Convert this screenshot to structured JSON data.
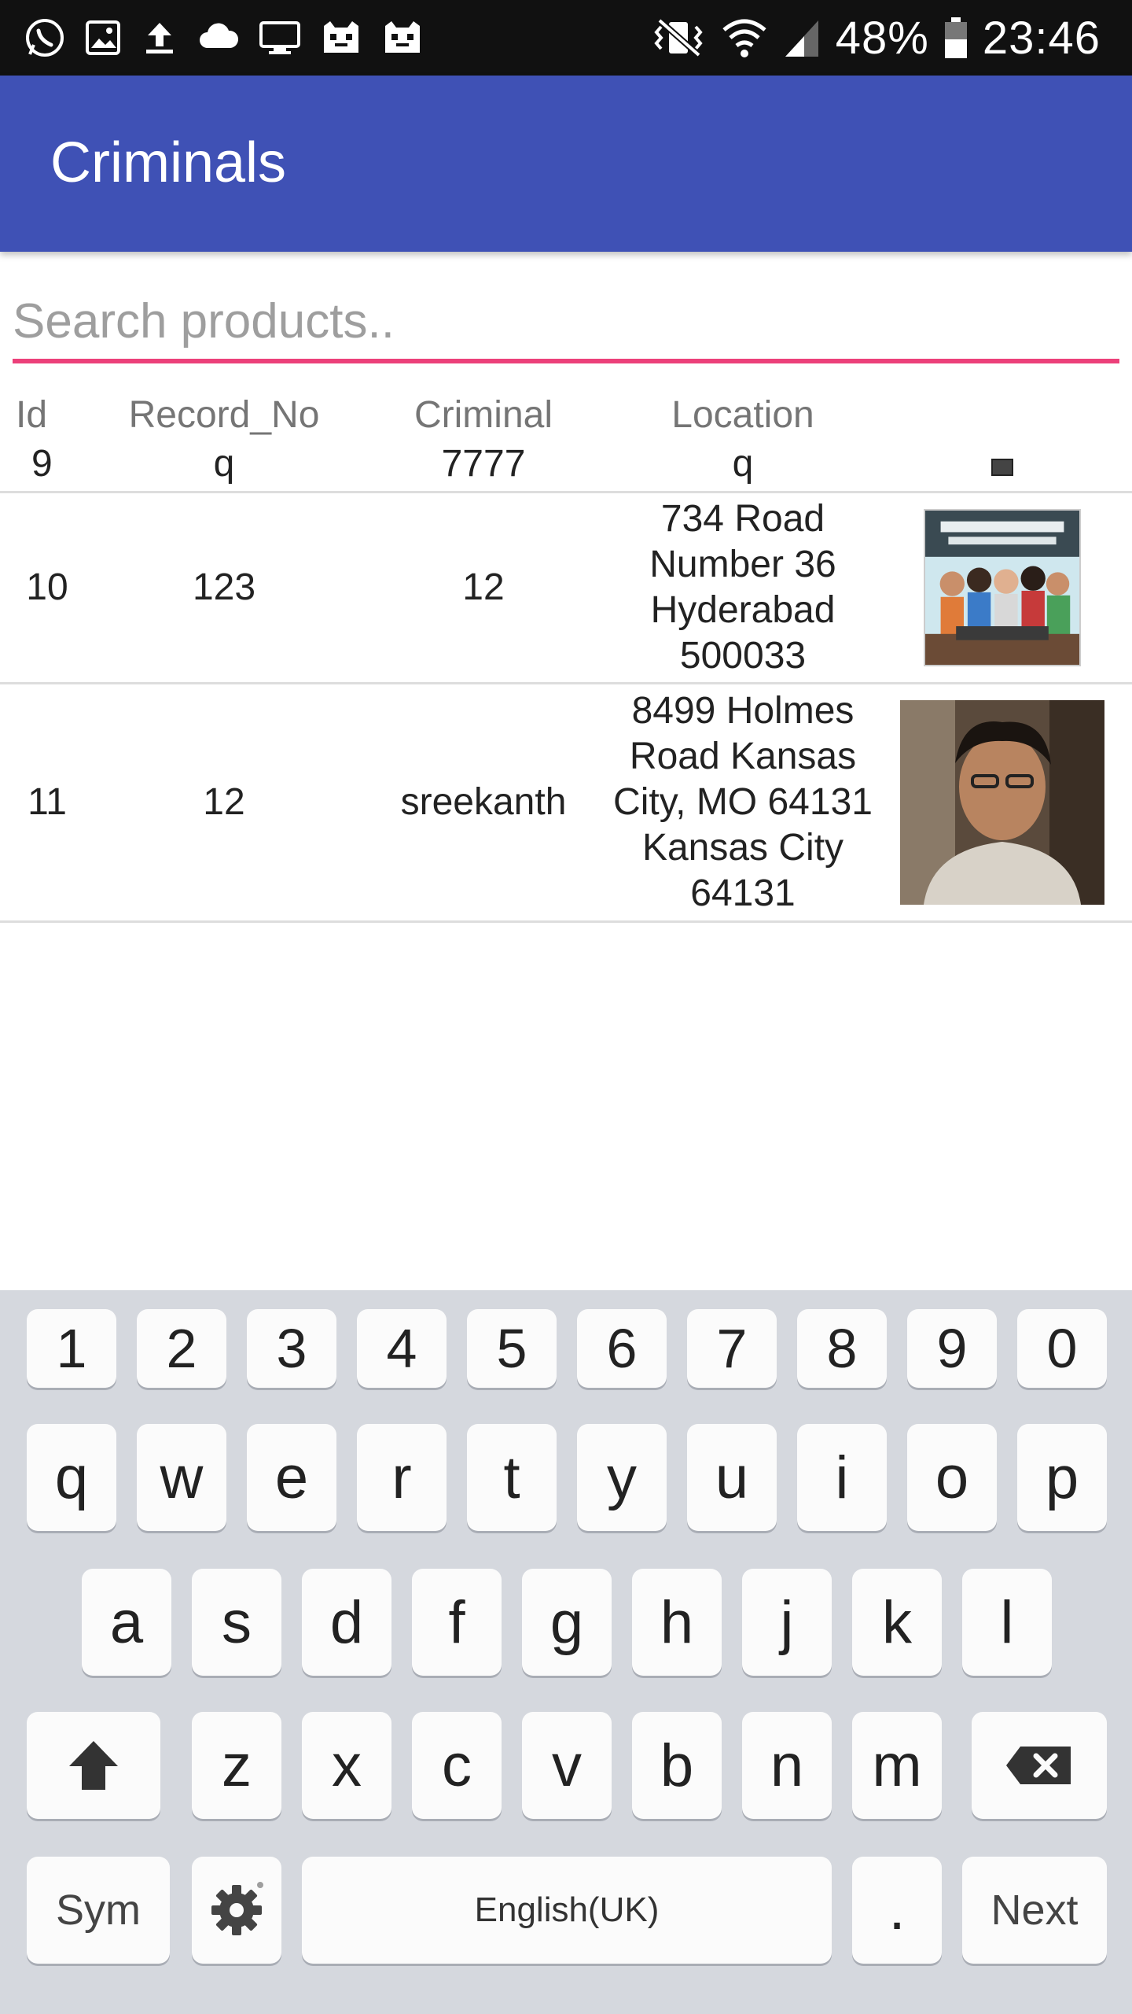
{
  "status_bar": {
    "battery_percent": "48%",
    "time": "23:46",
    "left_icons": [
      "whatsapp-icon",
      "image-icon",
      "upload-icon",
      "cloud-icon",
      "monitor-icon",
      "app-icon",
      "app-icon"
    ],
    "right_icons": [
      "vibrate-icon",
      "wifi-icon",
      "signal-icon",
      "battery-icon"
    ]
  },
  "appbar": {
    "title": "Criminals",
    "color": "#3F51B5"
  },
  "search": {
    "placeholder": "Search products..",
    "value": "",
    "underline_color": "#EC407A"
  },
  "table": {
    "columns": [
      "Id",
      "Record_No",
      "Criminal",
      "Location"
    ],
    "header_row": {
      "id": "9",
      "record_no": "q",
      "criminal": "7777",
      "location": "q"
    },
    "rows": [
      {
        "id": "10",
        "record_no": "123",
        "criminal": "12",
        "location": "734 Road Number 36 Hyderabad 500033",
        "image": "group-photo"
      },
      {
        "id": "11",
        "record_no": "12",
        "criminal": "sreekanth",
        "location": "8499 Holmes Road Kansas City, MO 64131 Kansas City 64131",
        "image": "person-photo"
      }
    ]
  },
  "keyboard": {
    "numbers": [
      "1",
      "2",
      "3",
      "4",
      "5",
      "6",
      "7",
      "8",
      "9",
      "0"
    ],
    "row1": [
      "q",
      "w",
      "e",
      "r",
      "t",
      "y",
      "u",
      "i",
      "o",
      "p"
    ],
    "row2": [
      "a",
      "s",
      "d",
      "f",
      "g",
      "h",
      "j",
      "k",
      "l"
    ],
    "row3": [
      "z",
      "x",
      "c",
      "v",
      "b",
      "n",
      "m"
    ],
    "sym": "Sym",
    "space": "English(UK)",
    "period": ".",
    "next": "Next"
  }
}
